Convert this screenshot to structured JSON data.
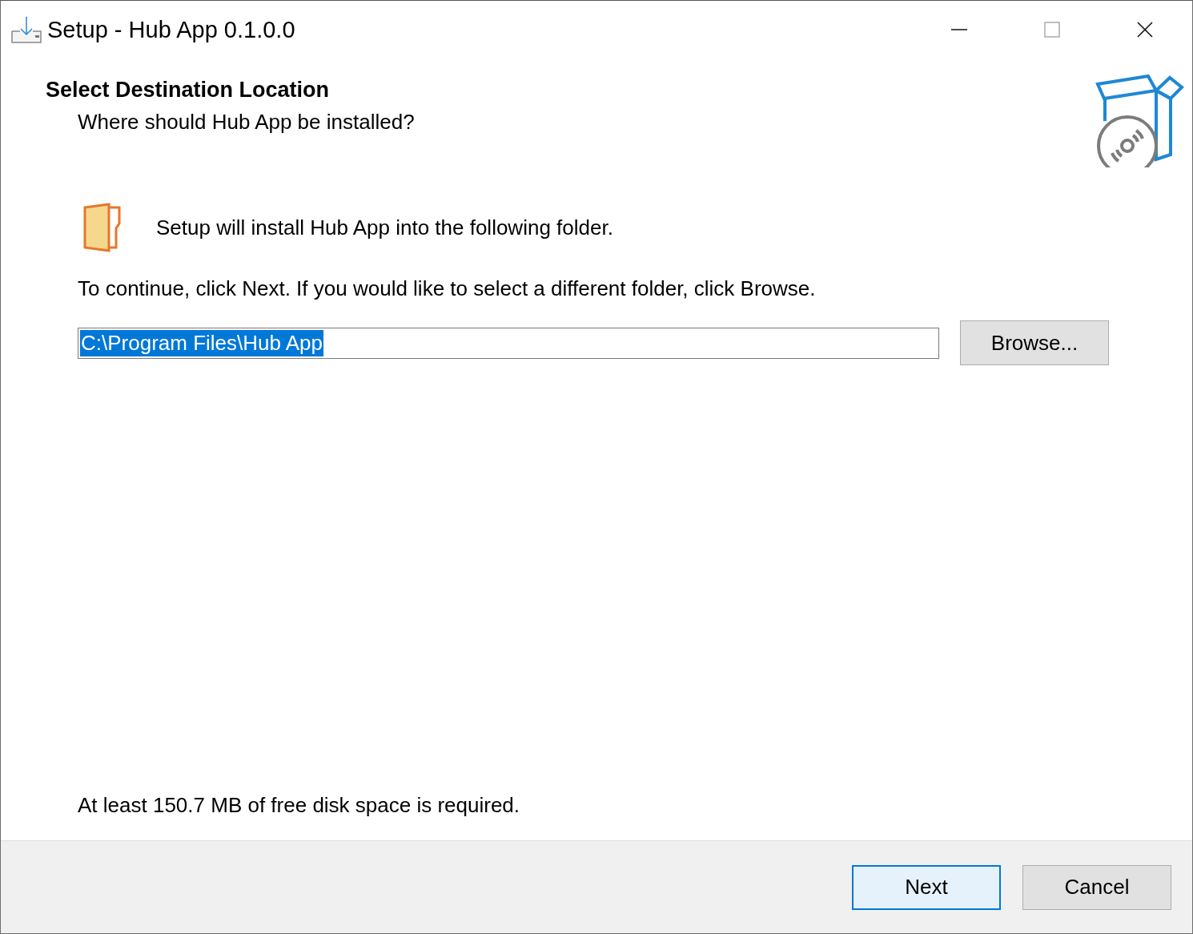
{
  "window": {
    "title": "Setup - Hub App 0.1.0.0"
  },
  "header": {
    "title": "Select Destination Location",
    "subtitle": "Where should Hub App be installed?"
  },
  "intro": "Setup will install Hub App into the following folder.",
  "instruction": "To continue, click Next. If you would like to select a different folder, click Browse.",
  "path_field": {
    "value": "C:\\Program Files\\Hub App",
    "text_selected": true
  },
  "browse_button": "Browse...",
  "disk_space": "At least 150.7 MB of free disk space is required.",
  "buttons": [
    {
      "label": "Next",
      "default": true
    },
    {
      "label": "Cancel",
      "default": false
    }
  ]
}
